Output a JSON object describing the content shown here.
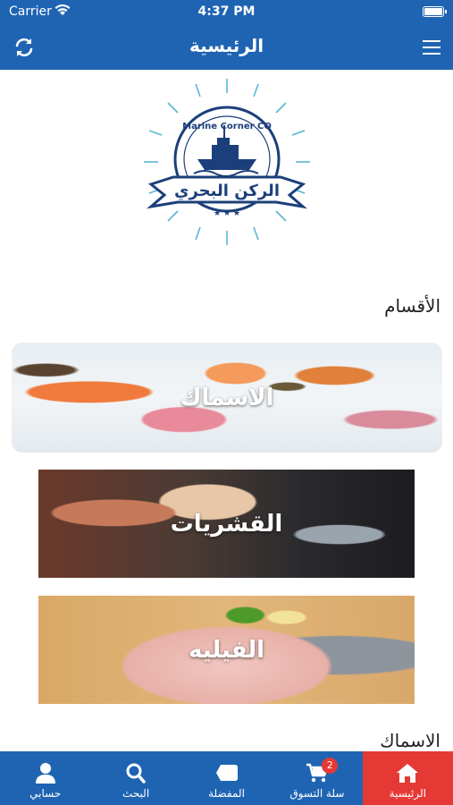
{
  "status_bar": {
    "carrier": "Carrier",
    "time": "4:37 PM"
  },
  "nav_bar": {
    "title": "الرئيسية"
  },
  "logo": {
    "brand_en": "Marine Corner CO",
    "brand_ar": "الركن البحري"
  },
  "sections": {
    "categories_title": "الأقسام",
    "fish_title": "الاسماك"
  },
  "categories": [
    {
      "label": "الاسماك"
    },
    {
      "label": "القشريات"
    },
    {
      "label": "الفيليه"
    }
  ],
  "tab_bar": {
    "items": [
      {
        "label": "حسابي",
        "icon": "account-icon"
      },
      {
        "label": "البحث",
        "icon": "search-icon"
      },
      {
        "label": "المفضلة",
        "icon": "favorites-icon"
      },
      {
        "label": "سلة التسوق",
        "icon": "cart-icon",
        "badge": "2"
      },
      {
        "label": "الرئيسية",
        "icon": "home-icon",
        "active": true
      }
    ]
  },
  "colors": {
    "primary": "#1f64b3",
    "active_tab": "#e53935"
  }
}
